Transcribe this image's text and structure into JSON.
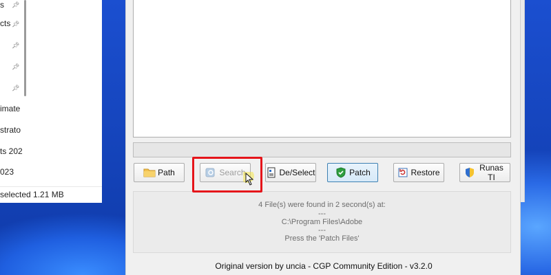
{
  "explorer": {
    "items": [
      {
        "label": "s",
        "pinned": true
      },
      {
        "label": "cts",
        "pinned": true
      },
      {
        "label": "",
        "pinned": true
      },
      {
        "label": "",
        "pinned": true
      },
      {
        "label": "",
        "pinned": true
      },
      {
        "label": "imate",
        "pinned": false
      },
      {
        "label": "strato",
        "pinned": false
      },
      {
        "label": "ts 202",
        "pinned": false
      },
      {
        "label": "023",
        "pinned": false
      }
    ],
    "status": "selected  1.21 MB"
  },
  "toolbar": {
    "path_label": "Path",
    "search_label": "Search",
    "deselect_label": "De/Select",
    "patch_label": "Patch",
    "restore_label": "Restore",
    "runas_label": "Runas TI"
  },
  "info": {
    "line1": "4 File(s) were found in 2 second(s) at:",
    "line2": "---",
    "line3": "C:\\Program Files\\Adobe",
    "line4": "---",
    "line5": "Press the 'Patch Files'"
  },
  "footer": {
    "text": "Original version by uncia - CGP Community Edition - v3.2.0"
  },
  "colors": {
    "highlight": "#e5141a",
    "patch_border": "#3c7fb1",
    "wallpaper": "#1d4fb8"
  }
}
